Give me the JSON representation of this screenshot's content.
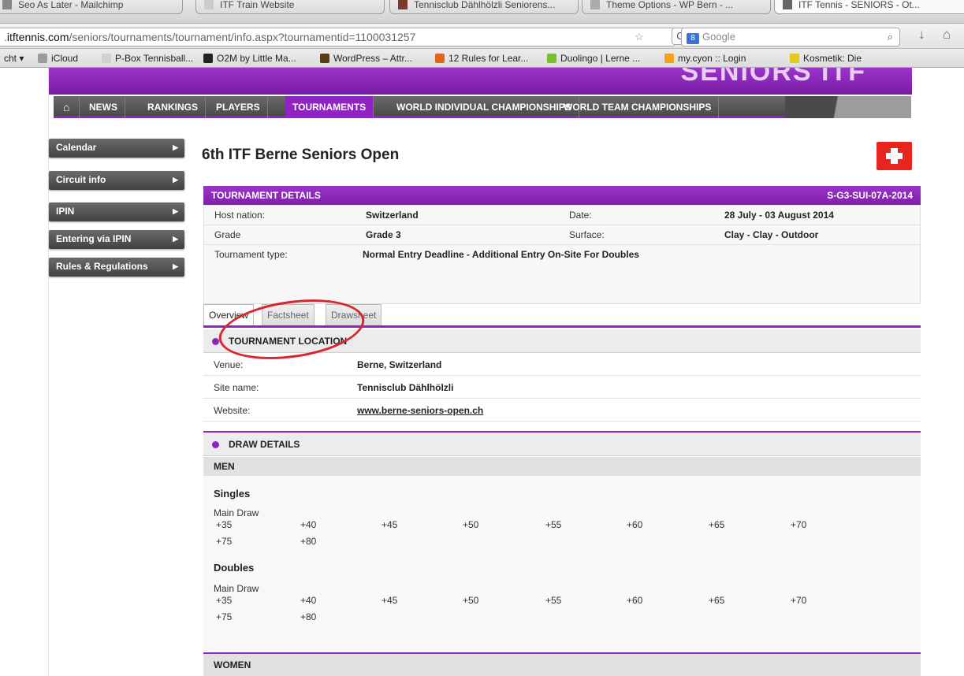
{
  "browser": {
    "tabs": [
      "Seo As Later - Mailchimp",
      "ITF Train Website",
      "Tennisclub Dählhölzli Seniorens...",
      "Theme Options - WP Bern - ...",
      "ITF Tennis - SENIORS - Ot..."
    ],
    "url_domain": "itftennis.com",
    "url_prefix": ".",
    "url_path": "/seniors/tournaments/tournament/info.aspx?tournamentid=1100031257",
    "search_placeholder": "Google",
    "search_engine_letter": "8",
    "bookmarks": [
      {
        "label": "cht ▾",
        "color": "transparent"
      },
      {
        "label": "iCloud",
        "color": "#9b9b9b"
      },
      {
        "label": "P-Box Tennisball...",
        "color": "#d0d0d0"
      },
      {
        "label": "O2M by Little Ma...",
        "color": "#222222"
      },
      {
        "label": "WordPress – Attr...",
        "color": "#5b3a1b"
      },
      {
        "label": "12 Rules for Lear...",
        "color": "#e2641f"
      },
      {
        "label": "Duolingo | Lerne ...",
        "color": "#7cbf2e"
      },
      {
        "label": "my.cyon :: Login",
        "color": "#f3a21d"
      },
      {
        "label": "Kosmetik: Die",
        "color": "#e6c81a"
      }
    ]
  },
  "site": {
    "brand": "SENIORS ITF",
    "nav": [
      "NEWS",
      "RANKINGS",
      "PLAYERS",
      "TOURNAMENTS",
      "WORLD INDIVIDUAL CHAMPIONSHIPS",
      "WORLD TEAM CHAMPIONSHIPS"
    ],
    "active_nav": "TOURNAMENTS",
    "sidebar": [
      "Calendar",
      "Circuit info",
      "IPIN",
      "Entering via IPIN",
      "Rules & Regulations"
    ]
  },
  "tournament": {
    "title": "6th ITF Berne Seniors Open",
    "details_header": "TOURNAMENT DETAILS",
    "code": "S-G3-SUI-07A-2014",
    "host_label": "Host nation:",
    "host_value": "Switzerland",
    "date_label": "Date:",
    "date_value": "28 July - 03 August 2014",
    "grade_label": "Grade",
    "grade_value": "Grade 3",
    "surface_label": "Surface:",
    "surface_value": "Clay - Clay - Outdoor",
    "type_label": "Tournament type:",
    "type_value": "Normal Entry Deadline - Additional Entry On-Site For Doubles"
  },
  "tabs": [
    "Overview",
    "Factsheet",
    "Drawsheet"
  ],
  "location": {
    "header": "TOURNAMENT LOCATION",
    "venue_label": "Venue:",
    "venue_value": "Berne, Switzerland",
    "site_label": "Site name:",
    "site_value": "Tennisclub Dählhölzli",
    "web_label": "Website:",
    "web_value": "www.berne-seniors-open.ch"
  },
  "draw": {
    "header": "DRAW DETAILS",
    "men": "MEN",
    "women": "WOMEN",
    "singles": "Singles",
    "doubles": "Doubles",
    "main_draw": "Main Draw",
    "ages_row1": [
      "+35",
      "+40",
      "+45",
      "+50",
      "+55",
      "+60",
      "+65",
      "+70"
    ],
    "ages_row2": [
      "+75",
      "+80"
    ]
  }
}
